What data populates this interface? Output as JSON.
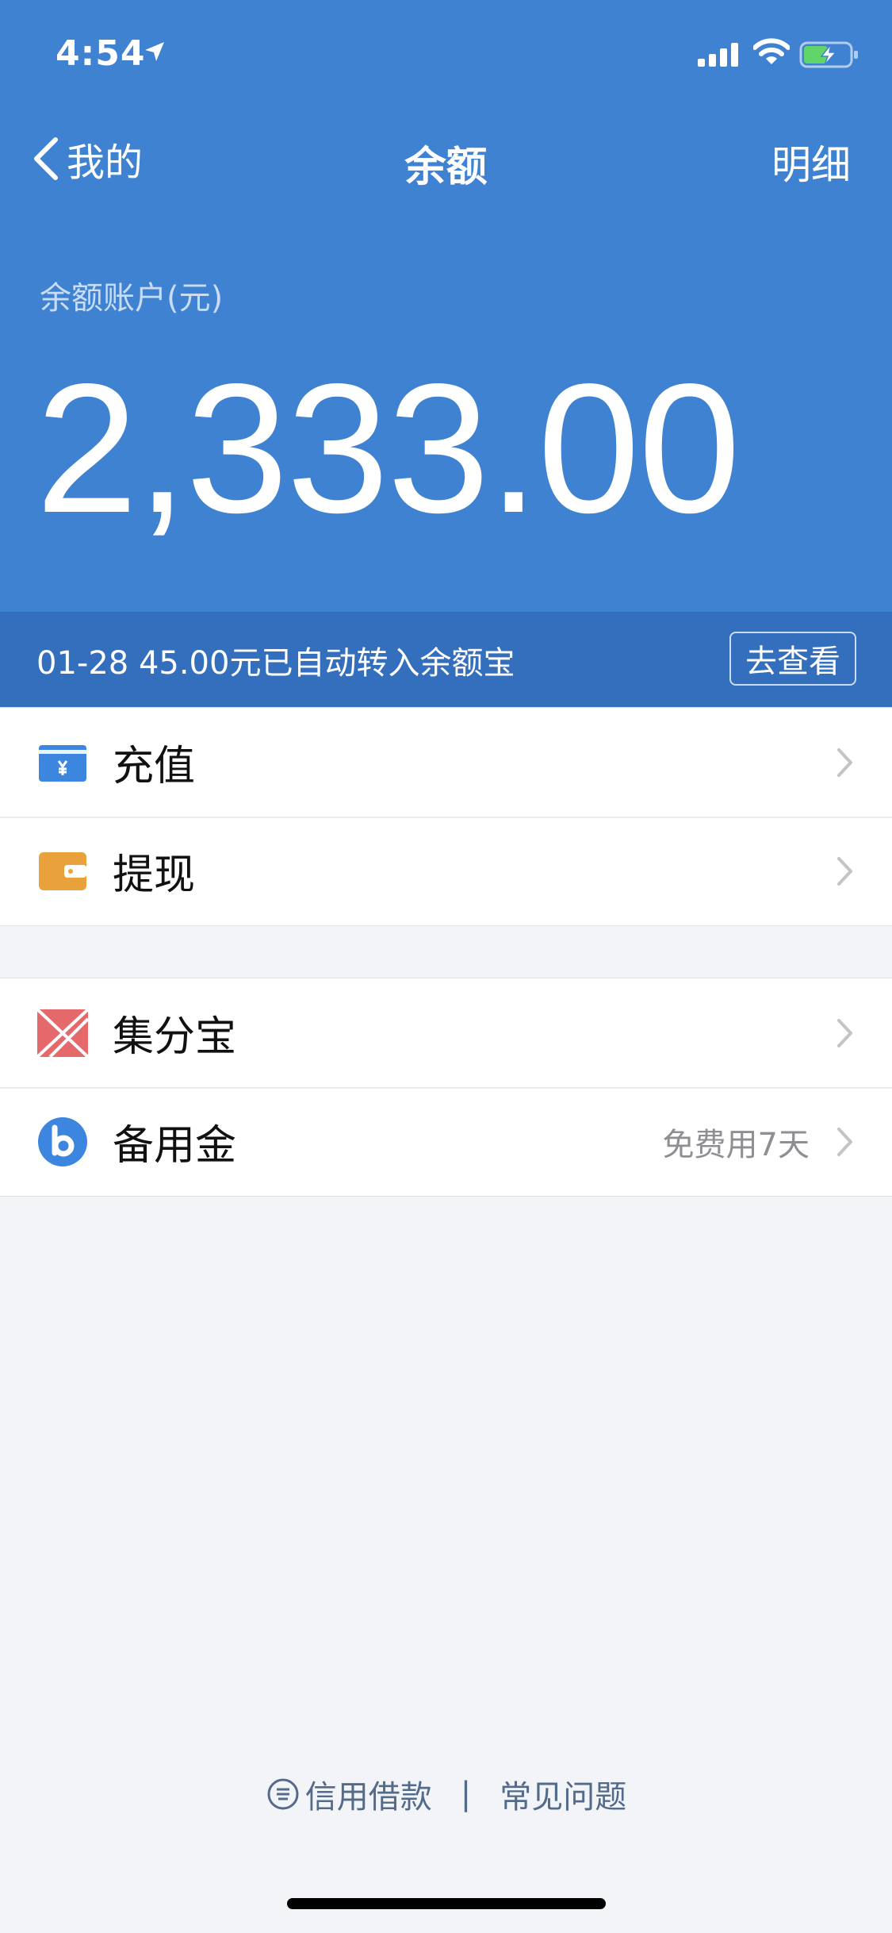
{
  "status_bar": {
    "time": "4:54",
    "icons": [
      "location-arrow-icon",
      "signal-icon",
      "wifi-icon",
      "battery-charging-icon"
    ]
  },
  "nav": {
    "back_label": "我的",
    "title": "余额",
    "right_action": "明细"
  },
  "balance": {
    "label": "余额账户(元)",
    "amount": "2,333.00"
  },
  "banner": {
    "text": "01-28 45.00元已自动转入余额宝",
    "button": "去查看"
  },
  "group1": [
    {
      "label": "充值",
      "icon": "recharge-card-icon",
      "color": "#3c86e0"
    },
    {
      "label": "提现",
      "icon": "withdraw-wallet-icon",
      "color": "#e9a23b"
    }
  ],
  "group2": [
    {
      "label": "集分宝",
      "icon": "jifenbao-icon",
      "color": "#e5686a",
      "sub": ""
    },
    {
      "label": "备用金",
      "icon": "beiyongjin-icon",
      "color": "#3c86e0",
      "sub": "免费用7天"
    }
  ],
  "footer": {
    "link1": "信用借款",
    "separator": "|",
    "link2": "常见问题"
  },
  "colors": {
    "header_bg": "#3e82d1",
    "banner_bg": "#336fbd",
    "page_bg": "#f3f4f7"
  }
}
